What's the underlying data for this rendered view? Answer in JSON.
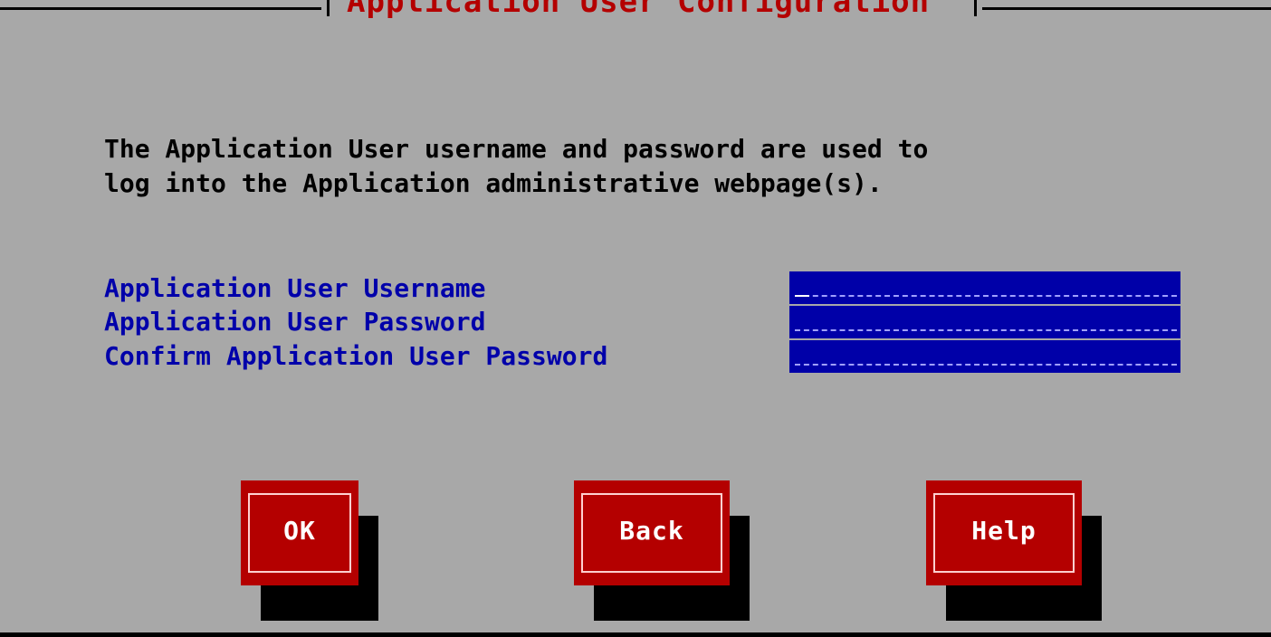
{
  "dialog": {
    "title": "Application User Configuration",
    "description_line1": "The Application User username and password are used to",
    "description_line2": "log into the Application administrative webpage(s).",
    "fields": [
      {
        "label": "Application User Username",
        "value": ""
      },
      {
        "label": "Application User Password",
        "value": ""
      },
      {
        "label": "Confirm Application User Password",
        "value": ""
      }
    ],
    "buttons": {
      "ok": "OK",
      "back": "Back",
      "help": "Help"
    }
  },
  "colors": {
    "background": "#a8a8a8",
    "title": "#b40000",
    "label": "#0000aa",
    "input_bg": "#0000a8",
    "button_bg": "#b40000",
    "button_text": "#ffffff"
  }
}
